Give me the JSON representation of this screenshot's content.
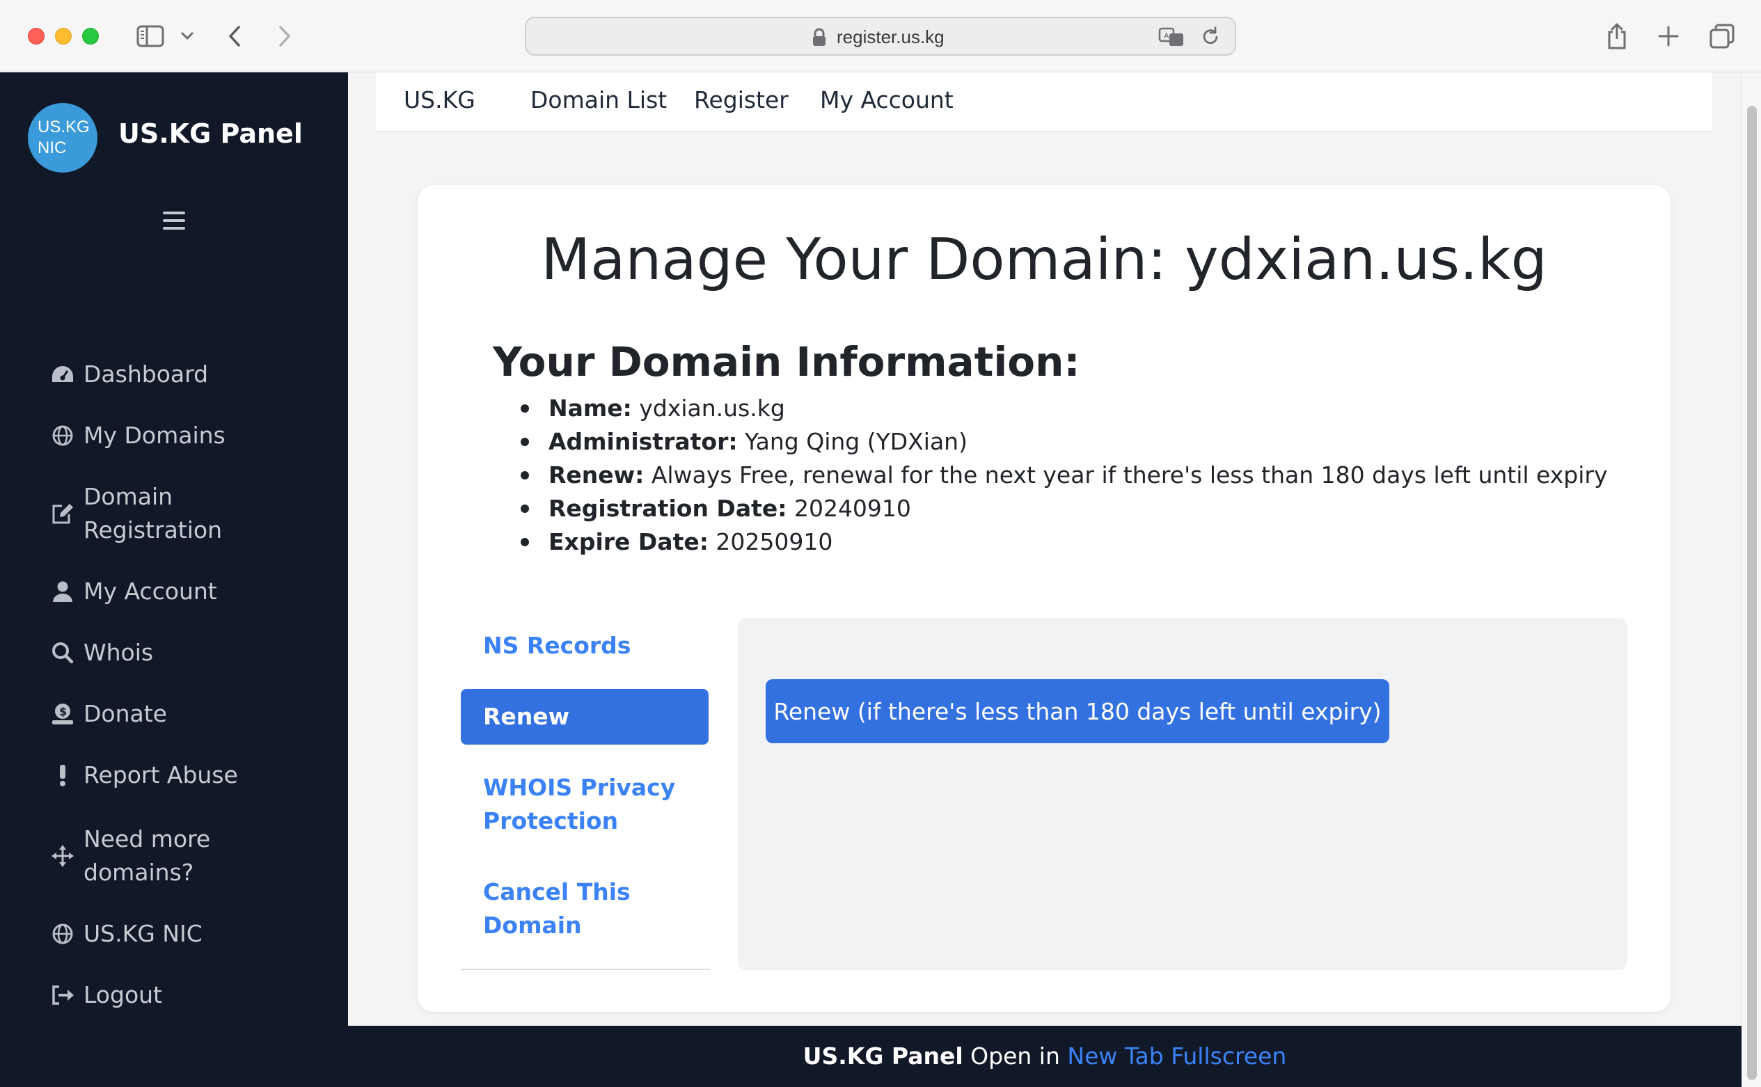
{
  "browser": {
    "url": "register.us.kg"
  },
  "sidebar": {
    "logo_text": "US.KG NIC",
    "brand_title": "US.KG Panel",
    "items": [
      {
        "label": "Dashboard",
        "icon": "gauge-icon"
      },
      {
        "label": "My Domains",
        "icon": "globe-icon"
      },
      {
        "label": "Domain Registration",
        "icon": "edit-icon"
      },
      {
        "label": "My Account",
        "icon": "user-icon"
      },
      {
        "label": "Whois",
        "icon": "search-icon"
      },
      {
        "label": "Donate",
        "icon": "donate-icon"
      },
      {
        "label": "Report Abuse",
        "icon": "exclamation-icon"
      },
      {
        "label": "Need more domains?",
        "icon": "move-icon"
      },
      {
        "label": "US.KG NIC",
        "icon": "globe-icon"
      },
      {
        "label": "Logout",
        "icon": "logout-icon"
      }
    ]
  },
  "topnav": {
    "items": [
      "US.KG",
      "Domain List",
      "Register",
      "My Account"
    ]
  },
  "main": {
    "title": "Manage Your Domain: ydxian.us.kg",
    "info_heading": "Your Domain Information:",
    "info": [
      {
        "label": "Name:",
        "value": "ydxian.us.kg"
      },
      {
        "label": "Administrator:",
        "value": "Yang Qing (YDXian)"
      },
      {
        "label": "Renew:",
        "value": "Always Free, renewal for the next year if there's less than 180 days left until expiry"
      },
      {
        "label": "Registration Date:",
        "value": "20240910"
      },
      {
        "label": "Expire Date:",
        "value": "20250910"
      }
    ],
    "tabs": [
      "NS Records",
      "Renew",
      "WHOIS Privacy Protection",
      "Cancel This Domain"
    ],
    "active_tab": "Renew",
    "renew_button": "Renew (if there's less than 180 days left until expiry)"
  },
  "footer": {
    "brand": "US.KG Panel",
    "open_in": "Open in",
    "link": "New Tab Fullscreen"
  },
  "colors": {
    "sidebar_bg": "#111827",
    "accent_blue": "#3370e0",
    "link_blue": "#3b82f6"
  }
}
